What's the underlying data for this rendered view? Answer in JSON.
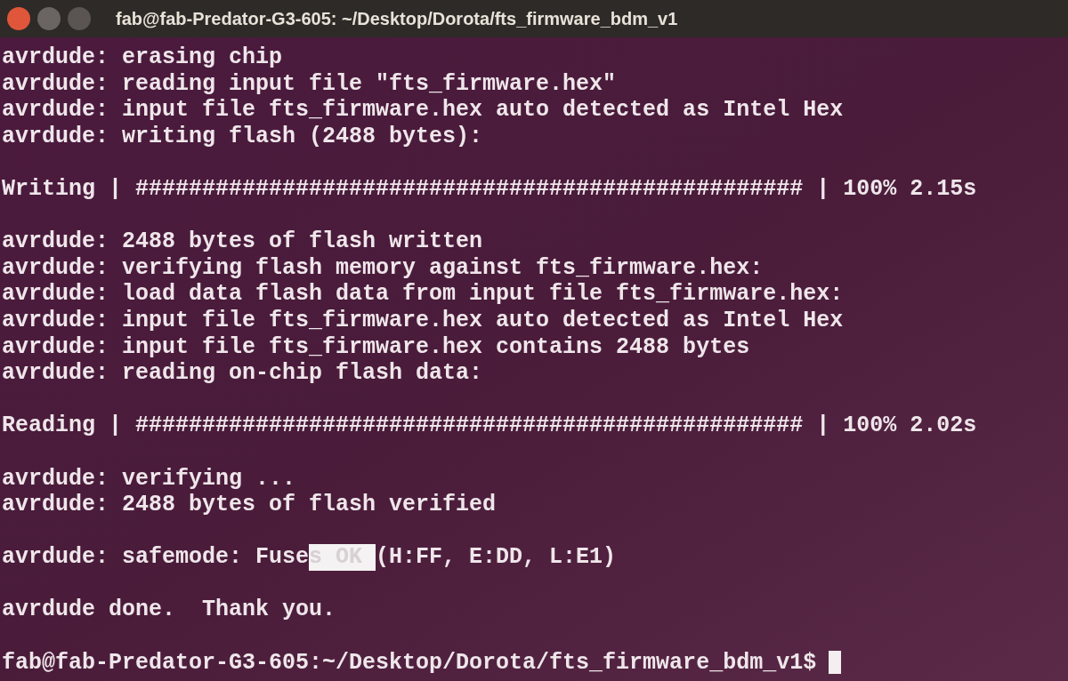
{
  "window": {
    "title": "fab@fab-Predator-G3-605: ~/Desktop/Dorota/fts_firmware_bdm_v1"
  },
  "lines": [
    {
      "kind": "text",
      "text": "avrdude: erasing chip"
    },
    {
      "kind": "text",
      "text": "avrdude: reading input file \"fts_firmware.hex\""
    },
    {
      "kind": "text",
      "text": "avrdude: input file fts_firmware.hex auto detected as Intel Hex"
    },
    {
      "kind": "text",
      "text": "avrdude: writing flash (2488 bytes):"
    },
    {
      "kind": "blank"
    },
    {
      "kind": "text",
      "text": "Writing | ################################################## | 100% 2.15s"
    },
    {
      "kind": "blank"
    },
    {
      "kind": "text",
      "text": "avrdude: 2488 bytes of flash written"
    },
    {
      "kind": "text",
      "text": "avrdude: verifying flash memory against fts_firmware.hex:"
    },
    {
      "kind": "text",
      "text": "avrdude: load data flash data from input file fts_firmware.hex:"
    },
    {
      "kind": "text",
      "text": "avrdude: input file fts_firmware.hex auto detected as Intel Hex"
    },
    {
      "kind": "text",
      "text": "avrdude: input file fts_firmware.hex contains 2488 bytes"
    },
    {
      "kind": "text",
      "text": "avrdude: reading on-chip flash data:"
    },
    {
      "kind": "blank"
    },
    {
      "kind": "text",
      "text": "Reading | ################################################## | 100% 2.02s"
    },
    {
      "kind": "blank"
    },
    {
      "kind": "text",
      "text": "avrdude: verifying ..."
    },
    {
      "kind": "text",
      "text": "avrdude: 2488 bytes of flash verified"
    },
    {
      "kind": "blank"
    },
    {
      "kind": "parts",
      "parts": [
        {
          "text": "avrdude: safemode: Fuse",
          "selected": false
        },
        {
          "text": "s OK ",
          "selected": true
        },
        {
          "text": "(H:FF, E:DD, L:E1)",
          "selected": false
        }
      ]
    },
    {
      "kind": "blank"
    },
    {
      "kind": "text",
      "text": "avrdude done.  Thank you."
    },
    {
      "kind": "blank"
    },
    {
      "kind": "prompt",
      "text": "fab@fab-Predator-G3-605:~/Desktop/Dorota/fts_firmware_bdm_v1$"
    }
  ]
}
